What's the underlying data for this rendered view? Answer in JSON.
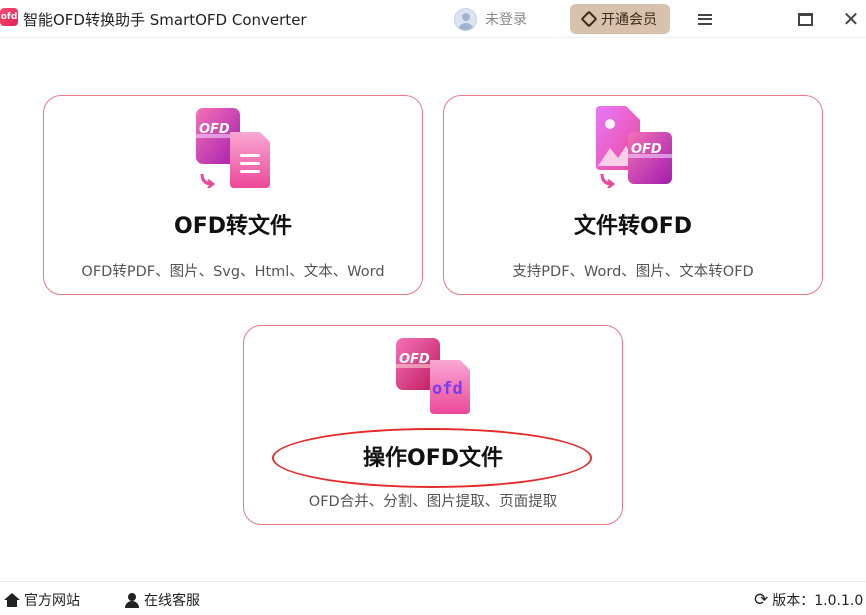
{
  "titlebar": {
    "app_icon_text": "ofd",
    "title": "智能OFD转换助手 SmartOFD Converter",
    "login_label": "未登录",
    "vip_label": "开通会员",
    "menu_icon": "hamburger-menu-icon",
    "maximize_icon": "maximize-icon",
    "close_icon": "close-icon",
    "close_glyph": "✕"
  },
  "cards": [
    {
      "title": "OFD转文件",
      "subtitle": "OFD转PDF、图片、Svg、Html、文本、Word",
      "icon": "ofd-to-file-icon"
    },
    {
      "title": "文件转OFD",
      "subtitle": "支持PDF、Word、图片、文本转OFD",
      "icon": "file-to-ofd-icon"
    },
    {
      "title": "操作OFD文件",
      "subtitle": "OFD合并、分割、图片提取、页面提取",
      "icon": "ofd-operate-icon"
    }
  ],
  "icon_text": {
    "ofd_upper": "OFD",
    "ofd_lower": "ofd"
  },
  "footer": {
    "website_label": "官方网站",
    "service_label": "在线客服",
    "version_label": "版本：1.0.1.0",
    "refresh_glyph": "⟳"
  },
  "colors": {
    "accent_pink": "#ec4899",
    "card_border": "#e97a85",
    "vip_bg": "#d9c2ad",
    "annotation_red": "#e52a2a"
  }
}
